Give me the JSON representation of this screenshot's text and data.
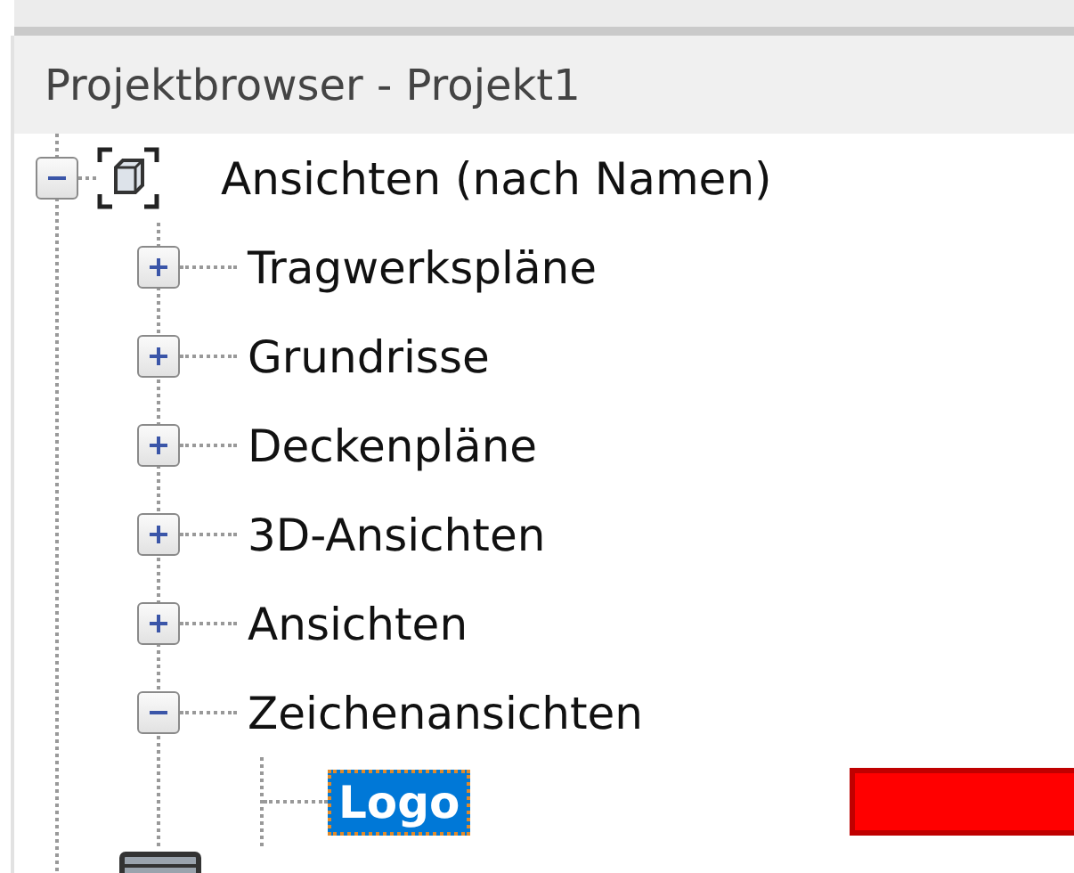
{
  "panel": {
    "title": "Projektbrowser - Projekt1"
  },
  "tree": [
    {
      "label": "Ansichten (nach Namen)",
      "kind": "views",
      "expanded": true,
      "selected": false,
      "children": [
        {
          "label": "Tragwerkspläne",
          "expanded": false,
          "selected": false
        },
        {
          "label": "Grundrisse",
          "expanded": false,
          "selected": false
        },
        {
          "label": "Deckenpläne",
          "expanded": false,
          "selected": false
        },
        {
          "label": "3D-Ansichten",
          "expanded": false,
          "selected": false
        },
        {
          "label": "Ansichten",
          "expanded": false,
          "selected": false
        },
        {
          "label": "Zeichenansichten",
          "expanded": true,
          "selected": false,
          "children": [
            {
              "label": "Logo",
              "selected": true,
              "marker": true
            }
          ]
        }
      ]
    }
  ]
}
